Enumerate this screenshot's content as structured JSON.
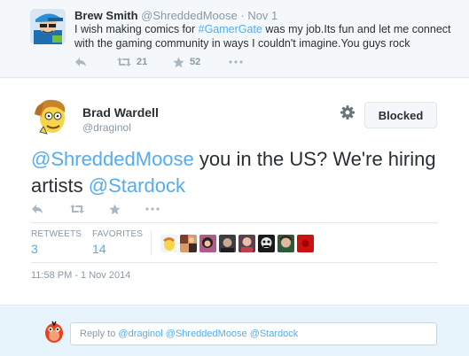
{
  "parent_tweet": {
    "author_name": "Brew Smith",
    "author_handle": "@ShreddedMoose",
    "separator": " · ",
    "date": "Nov 1",
    "text_before": "I wish making comics for ",
    "hashtag": "#GamerGate",
    "text_after": " was my job.Its fun and let me connect with the gaming community in ways I couldn't imagine.You guys rock",
    "retweet_count": "21",
    "favorite_count": "52"
  },
  "main_tweet": {
    "author_name": "Brad Wardell",
    "author_handle": "@draginol",
    "blocked_label": "Blocked",
    "mention_1": "@ShreddedMoose",
    "text_middle": " you in the US? We're hiring artists ",
    "mention_2": "@Stardock",
    "retweets_label": "RETWEETS",
    "retweets_count": "3",
    "favorites_label": "FAVORITES",
    "favorites_count": "14",
    "timestamp": "11:58 PM - 1 Nov 2014"
  },
  "reply_box": {
    "prefix": "Reply to ",
    "mentions": "@draginol @ShreddedMoose @Stardock"
  },
  "colors": {
    "link": "#55acee",
    "muted": "#8899a6",
    "text": "#292f33",
    "background": "#f5f8fa",
    "reply_background": "#e8f4fb"
  },
  "icons": [
    "reply-icon",
    "retweet-icon",
    "favorite-star-icon",
    "more-dots-icon",
    "gear-icon"
  ]
}
